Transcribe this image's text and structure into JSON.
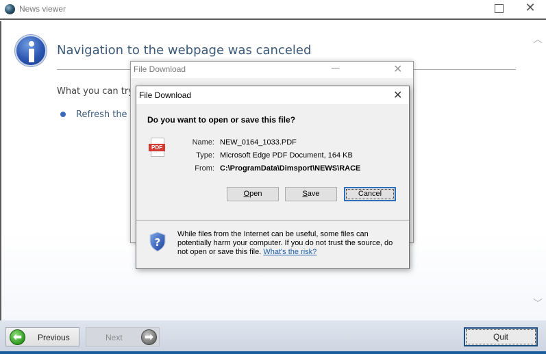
{
  "window": {
    "title": "News viewer",
    "icon": "globe-icon",
    "controls": {
      "maximize": "maximize-icon",
      "close": "close-icon",
      "close_glyph": "✕"
    }
  },
  "content": {
    "heading": "Navigation to the webpage was canceled",
    "try_label": "What you can try:",
    "suggestions": [
      {
        "label": "Refresh the page."
      }
    ],
    "scroll_up_glyph": "︿",
    "scroll_down_glyph": "﹀"
  },
  "background_dialog": {
    "title": "File Download",
    "minimize_glyph": "—",
    "close_glyph": "✕"
  },
  "dialog": {
    "title": "File Download",
    "close_glyph": "✕",
    "question": "Do you want to open or save this file?",
    "file_icon_label": "PDF",
    "fields": [
      {
        "label": "Name:",
        "value": "NEW_0164_1033.PDF",
        "bold": false
      },
      {
        "label": "Type:",
        "value": "Microsoft Edge PDF Document, 164 KB",
        "bold": false
      },
      {
        "label": "From:",
        "value": "C:\\ProgramData\\Dimsport\\NEWS\\RACE",
        "bold": true
      }
    ],
    "buttons": {
      "open": {
        "mnemonic": "O",
        "rest": "pen"
      },
      "save": {
        "mnemonic": "S",
        "rest": "ave"
      },
      "cancel": "Cancel"
    },
    "warning_text": "While files from the Internet can be useful, some files can potentially harm your computer. If you do not trust the source, do not open or save this file.",
    "risk_link": "What's the risk?"
  },
  "footer": {
    "previous": "Previous",
    "next": "Next",
    "quit": "Quit",
    "previous_glyph": "⬅",
    "next_glyph": "➡"
  },
  "colors": {
    "heading": "#3b5a7a",
    "link": "#1d5fa8",
    "focus_border": "#2a6fb8",
    "pdf_badge": "#d23a32",
    "footer_strip": "#1c5c9c"
  }
}
